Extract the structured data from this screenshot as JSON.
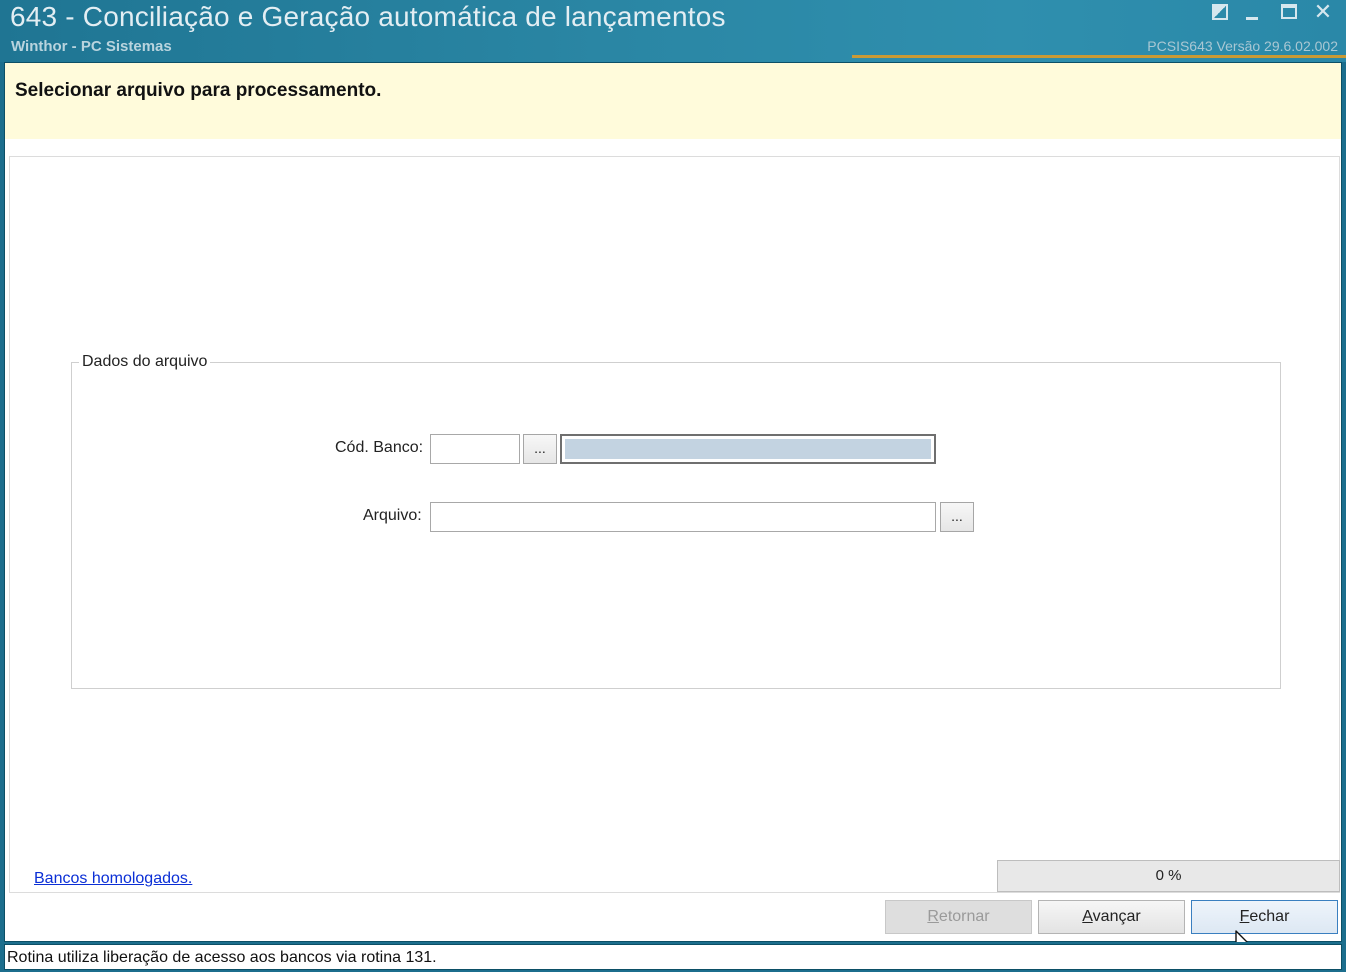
{
  "window": {
    "title": "643 - Conciliação e Geração automática de lançamentos",
    "subtitle": "Winthor - PC Sistemas",
    "version": "PCSIS643  Versão  29.6.02.002"
  },
  "header": {
    "title": "Selecionar arquivo para processamento."
  },
  "group": {
    "legend": "Dados do arquivo",
    "banco_label": "Cód. Banco:",
    "banco_value": "",
    "banco_lookup": "...",
    "arquivo_label": "Arquivo:",
    "arquivo_value": "",
    "arquivo_lookup": "..."
  },
  "footer": {
    "link": "Bancos homologados.",
    "progress_text": "0 %",
    "progress_fraction": 0,
    "buttons": {
      "retornar": "Retornar",
      "avancar": "Avançar",
      "fechar": "Fechar"
    }
  },
  "status": {
    "text": "Rotina utiliza liberação de acesso aos bancos via rotina 131."
  },
  "colors": {
    "titlebar": "#1f7593",
    "header_band": "#fffbdb",
    "link": "#0b2fd6",
    "accent": "#c99a35"
  },
  "icons": {
    "restore": "restore-icon",
    "minimize": "minimize-icon",
    "maximize": "maximize-icon",
    "close": "close-icon",
    "cursor": "mouse-pointer-icon"
  }
}
